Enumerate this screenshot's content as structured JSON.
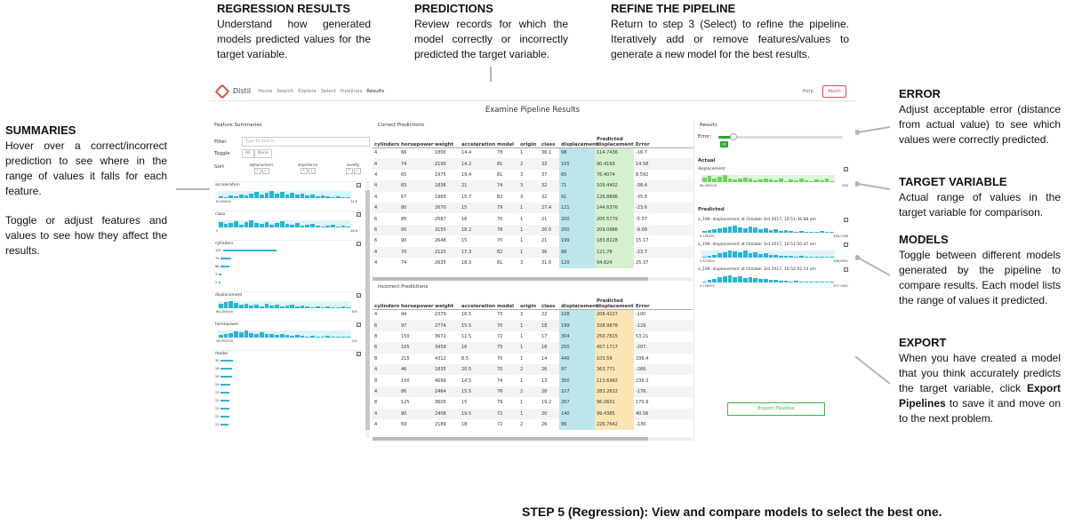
{
  "annotations": {
    "summaries": {
      "title": "SUMMARIES",
      "p1": "Hover over a correct/incorrect prediction to see where in the range of values it falls for each feature.",
      "p2": "Toggle or adjust features and values to see how they affect the results."
    },
    "regression": {
      "title": "REGRESSION RESULTS",
      "body": "Understand how generated models predicted values for the target variable."
    },
    "predictions": {
      "title": "PREDICTIONS",
      "body": "Review records for which the model correctly or incorrectly predicted the target variable."
    },
    "refine": {
      "title": "REFINE THE PIPELINE",
      "body": "Return to step 3 (Select) to refine the pipeline. Iteratively add or remove features/values to generate a new model for the best results."
    },
    "error": {
      "title": "ERROR",
      "body": "Adjust acceptable error (distance from actual value) to see which values were correctly predicted."
    },
    "target": {
      "title": "TARGET VARIABLE",
      "body": "Actual range of values in the target variable for comparison."
    },
    "models": {
      "title": "MODELS",
      "body": "Toggle between different models generated by the pipeline to compare results. Each model lists the range of values it predicted."
    },
    "export": {
      "title": "EXPORT",
      "body_pre": "When you have created a model that you think accurately predicts the target variable, click ",
      "body_bold": "Export Pipelines",
      "body_post": " to save it and move on to the next problem."
    }
  },
  "caption": "STEP 5 (Regression): View and compare models to select the best one.",
  "app": {
    "brand": "Distil",
    "nav": [
      "Home",
      "Search",
      "Explore",
      "Select",
      "Pipelines",
      "Results"
    ],
    "nav_active": "Results",
    "help": "Help",
    "abort": "Abort",
    "page_title": "Examine Pipeline Results",
    "summaries": {
      "heading": "Feature Summaries",
      "filter_label": "Filter",
      "filter_placeholder": "Type to Search",
      "toggle_label": "Toggle",
      "toggle_all": "All",
      "toggle_none": "None",
      "sort_label": "Sort",
      "sort_groups": [
        "alphanumeric",
        "importance",
        "novelty"
      ],
      "features": [
        {
          "name": "acceleration",
          "type": "numeric",
          "min": "8.000000",
          "max": "24.8",
          "bins": [
            2,
            1,
            3,
            2,
            4,
            3,
            6,
            8,
            5,
            7,
            9,
            6,
            8,
            5,
            7,
            4,
            6,
            3,
            5,
            2,
            3,
            2,
            1,
            2,
            1,
            1
          ]
        },
        {
          "name": "class",
          "type": "numeric",
          "min": "0",
          "max": "46.6",
          "bins": [
            6,
            4,
            5,
            7,
            3,
            6,
            8,
            5,
            4,
            6,
            3,
            5,
            7,
            4,
            3,
            5,
            2,
            3,
            4,
            2,
            1,
            2,
            3,
            1,
            2,
            1
          ]
        },
        {
          "name": "cylinders",
          "type": "categorical",
          "cats": [
            {
              "label": "145",
              "w": 60
            },
            {
              "label": "74",
              "w": 12
            },
            {
              "label": "68",
              "w": 10
            },
            {
              "label": "3",
              "w": 3
            },
            {
              "label": "5",
              "w": 2
            }
          ]
        },
        {
          "name": "displacement",
          "type": "numeric",
          "min": "68.000000",
          "max": "455",
          "bins": [
            5,
            7,
            8,
            6,
            4,
            5,
            3,
            4,
            2,
            5,
            3,
            4,
            2,
            3,
            4,
            2,
            3,
            2,
            1,
            2,
            1,
            2,
            1,
            1,
            2,
            1
          ]
        },
        {
          "name": "horsepower",
          "type": "numeric",
          "min": "46.000000",
          "max": "225",
          "bins": [
            3,
            5,
            6,
            8,
            7,
            9,
            6,
            5,
            7,
            4,
            5,
            3,
            4,
            3,
            2,
            3,
            2,
            1,
            2,
            1,
            1,
            2,
            1,
            1,
            1,
            1
          ]
        },
        {
          "name": "model",
          "type": "categorical",
          "cats": [
            {
              "label": "30",
              "w": 14
            },
            {
              "label": "28",
              "w": 13
            },
            {
              "label": "28",
              "w": 13
            },
            {
              "label": "24",
              "w": 11
            },
            {
              "label": "23",
              "w": 10
            },
            {
              "label": "22",
              "w": 10
            },
            {
              "label": "22",
              "w": 10
            },
            {
              "label": "22",
              "w": 10
            },
            {
              "label": "21",
              "w": 9
            }
          ]
        }
      ]
    },
    "correct": {
      "heading": "Correct Predictions",
      "columns": [
        "cylinders",
        "horsepower",
        "weight",
        "acceleration",
        "model",
        "origin",
        "class",
        "displacement",
        "Predicted displacement",
        "Error"
      ],
      "rows": [
        [
          "4",
          "66",
          "1800",
          "14.4",
          "78",
          "1",
          "36.1",
          "98",
          "114.7436",
          "-16.7"
        ],
        [
          "4",
          "74",
          "2190",
          "14.2",
          "81",
          "2",
          "33",
          "105",
          "90.4169",
          "14.58"
        ],
        [
          "4",
          "65",
          "1975",
          "19.4",
          "81",
          "3",
          "37",
          "85",
          "76.4074",
          "8.592"
        ],
        [
          "4",
          "65",
          "1836",
          "21",
          "74",
          "3",
          "32",
          "71",
          "109.4402",
          "-38.4"
        ],
        [
          "4",
          "67",
          "1965",
          "15.7",
          "82",
          "3",
          "32",
          "91",
          "126.8896",
          "-35.8"
        ],
        [
          "4",
          "80",
          "2670",
          "15",
          "79",
          "1",
          "27.4",
          "121",
          "144.6376",
          "-23.6"
        ],
        [
          "6",
          "85",
          "2587",
          "16",
          "70",
          "1",
          "21",
          "200",
          "205.5779",
          "-5.57"
        ],
        [
          "6",
          "95",
          "3155",
          "18.2",
          "78",
          "1",
          "20.5",
          "200",
          "209.0986",
          "-9.09"
        ],
        [
          "6",
          "90",
          "2648",
          "15",
          "70",
          "1",
          "21",
          "199",
          "183.8228",
          "15.17"
        ],
        [
          "4",
          "70",
          "2125",
          "17.3",
          "82",
          "1",
          "36",
          "98",
          "121.78",
          "-23.7"
        ],
        [
          "4",
          "74",
          "2635",
          "18.3",
          "81",
          "3",
          "31.6",
          "120",
          "94.624",
          "25.37"
        ]
      ]
    },
    "incorrect": {
      "heading": "Incorrect Predictions",
      "columns": [
        "cylinders",
        "horsepower",
        "weight",
        "acceleration",
        "model",
        "origin",
        "class",
        "displacement",
        "Predicted displacement",
        "Error"
      ],
      "rows": [
        [
          "4",
          "94",
          "2379",
          "16.5",
          "73",
          "3",
          "22",
          "108",
          "208.4227",
          "-100."
        ],
        [
          "6",
          "97",
          "2774",
          "15.5",
          "70",
          "1",
          "18",
          "199",
          "328.9878",
          "-129."
        ],
        [
          "8",
          "150",
          "3672",
          "11.5",
          "72",
          "1",
          "17",
          "304",
          "250.7815",
          "53.21"
        ],
        [
          "6",
          "105",
          "3459",
          "16",
          "75",
          "1",
          "18",
          "250",
          "457.1717",
          "-207."
        ],
        [
          "8",
          "215",
          "4312",
          "8.5",
          "70",
          "1",
          "14",
          "440",
          "103.59",
          "336.4"
        ],
        [
          "4",
          "46",
          "1835",
          "20.5",
          "70",
          "2",
          "26",
          "97",
          "363.771",
          "-266."
        ],
        [
          "8",
          "150",
          "4699",
          "14.5",
          "74",
          "1",
          "13",
          "350",
          "113.6992",
          "236.3"
        ],
        [
          "4",
          "86",
          "2464",
          "15.5",
          "76",
          "2",
          "28",
          "107",
          "283.2632",
          "-176."
        ],
        [
          "8",
          "125",
          "3605",
          "15",
          "79",
          "1",
          "19.2",
          "267",
          "96.0601",
          "170.9"
        ],
        [
          "4",
          "90",
          "2408",
          "19.5",
          "72",
          "1",
          "20",
          "140",
          "99.4385",
          "40.56"
        ],
        [
          "4",
          "69",
          "2189",
          "18",
          "72",
          "2",
          "26",
          "96",
          "226.7642",
          "-130."
        ]
      ]
    },
    "results": {
      "heading": "Results",
      "error_label": "Error:",
      "error_value": "40",
      "error_fraction": 0.12,
      "actual_heading": "Actual",
      "actual": {
        "label": "displacement",
        "min": "68.000000",
        "max": "455",
        "color": "#6cd65c",
        "bg": "#dff4dc",
        "bins": [
          6,
          8,
          5,
          7,
          9,
          4,
          3,
          5,
          6,
          4,
          2,
          3,
          5,
          3,
          2,
          4,
          1,
          3,
          2,
          5,
          2,
          1,
          3,
          2,
          4,
          1
        ]
      },
      "predicted_heading": "Predicted",
      "models": [
        {
          "label": "o_196: displacement at October 3rd 2017, 10:51:36.88 am",
          "min": "0.765300",
          "max": "466.2768",
          "color": "#2ab5d4",
          "bg": "#ffffff",
          "bins": [
            2,
            3,
            4,
            5,
            6,
            7,
            8,
            6,
            5,
            7,
            6,
            4,
            5,
            3,
            4,
            2,
            3,
            2,
            1,
            2,
            1,
            1,
            1,
            2,
            1,
            1
          ]
        },
        {
          "label": "o_196: displacement at October 3rd 2017, 10:51:50.47 am",
          "min": "0.823400",
          "max": "466.9891",
          "color": "#2ab5d4",
          "bg": "#def4f8",
          "bins": [
            1,
            2,
            3,
            5,
            6,
            8,
            7,
            6,
            8,
            5,
            6,
            4,
            5,
            3,
            3,
            2,
            2,
            2,
            1,
            2,
            1,
            1,
            1,
            1,
            1,
            1
          ]
        },
        {
          "label": "o_196: displacement at October 3rd 2017, 10:52:02.14 am",
          "min": "0.728900",
          "max": "497.2882",
          "color": "#2ab5d4",
          "bg": "#ffffff",
          "bins": [
            1,
            3,
            4,
            6,
            7,
            8,
            6,
            7,
            5,
            6,
            5,
            4,
            4,
            3,
            3,
            2,
            2,
            1,
            2,
            1,
            1,
            1,
            1,
            1,
            1,
            1
          ]
        }
      ],
      "export_label": "Export Pipeline"
    }
  }
}
